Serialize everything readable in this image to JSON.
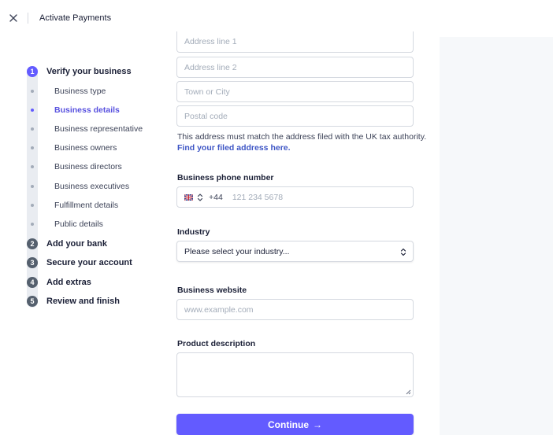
{
  "header": {
    "title": "Activate Payments",
    "close_icon": "close-icon"
  },
  "colors": {
    "accent": "#635bff",
    "link": "#3d55c5",
    "step_inactive": "#55606e"
  },
  "stepper": {
    "steps": [
      {
        "number": "1",
        "label": "Verify your business",
        "active": true
      },
      {
        "number": "2",
        "label": "Add your bank"
      },
      {
        "number": "3",
        "label": "Secure your account"
      },
      {
        "number": "4",
        "label": "Add extras"
      },
      {
        "number": "5",
        "label": "Review and finish"
      }
    ],
    "substeps": [
      "Business type",
      "Business details",
      "Business representative",
      "Business owners",
      "Business directors",
      "Business executives",
      "Fulfillment details",
      "Public details"
    ],
    "active_substep": "Business details"
  },
  "address": {
    "line1_placeholder": "Address line 1",
    "line2_placeholder": "Address line 2",
    "town_placeholder": "Town or City",
    "postcode_placeholder": "Postal code",
    "help_text": "This address must match the address filed with the UK tax authority.",
    "help_link": "Find your filed address here."
  },
  "phone": {
    "label": "Business phone number",
    "country_code": "+44",
    "placeholder": "121 234 5678",
    "flag_icon": "uk-flag-icon"
  },
  "industry": {
    "label": "Industry",
    "selected": "Please select your industry..."
  },
  "website": {
    "label": "Business website",
    "placeholder": "www.example.com"
  },
  "product": {
    "label": "Product description",
    "value": ""
  },
  "continue_button": {
    "label": "Continue",
    "arrow": "→"
  }
}
